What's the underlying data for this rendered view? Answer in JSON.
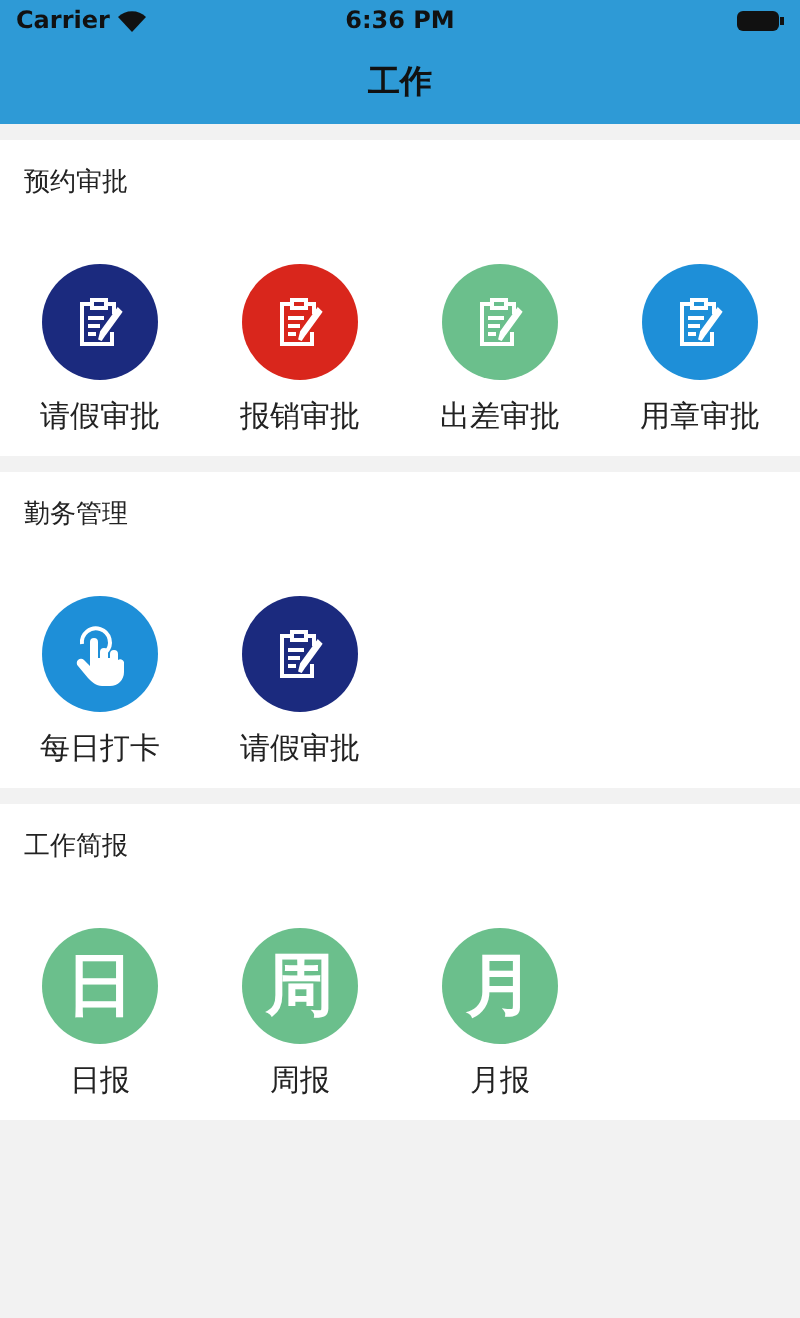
{
  "status_bar": {
    "carrier": "Carrier",
    "time": "6:36 PM"
  },
  "nav": {
    "title": "工作"
  },
  "sections": [
    {
      "title": "预约审批",
      "items": [
        {
          "label": "请假审批",
          "kind": "clipboard",
          "color": "#1b2a7e"
        },
        {
          "label": "报销审批",
          "kind": "clipboard",
          "color": "#d9261c"
        },
        {
          "label": "出差审批",
          "kind": "clipboard",
          "color": "#6bbf8c"
        },
        {
          "label": "用章审批",
          "kind": "clipboard",
          "color": "#1e8fd8"
        }
      ]
    },
    {
      "title": "勤务管理",
      "items": [
        {
          "label": "每日打卡",
          "kind": "hand",
          "color": "#1e8fd8"
        },
        {
          "label": "请假审批",
          "kind": "clipboard",
          "color": "#1b2a7e"
        }
      ]
    },
    {
      "title": "工作简报",
      "items": [
        {
          "label": "日报",
          "kind": "glyph",
          "glyph": "日",
          "color": "#6bbf8c"
        },
        {
          "label": "周报",
          "kind": "glyph",
          "glyph": "周",
          "color": "#6bbf8c"
        },
        {
          "label": "月报",
          "kind": "glyph",
          "glyph": "月",
          "color": "#6bbf8c"
        }
      ]
    }
  ]
}
